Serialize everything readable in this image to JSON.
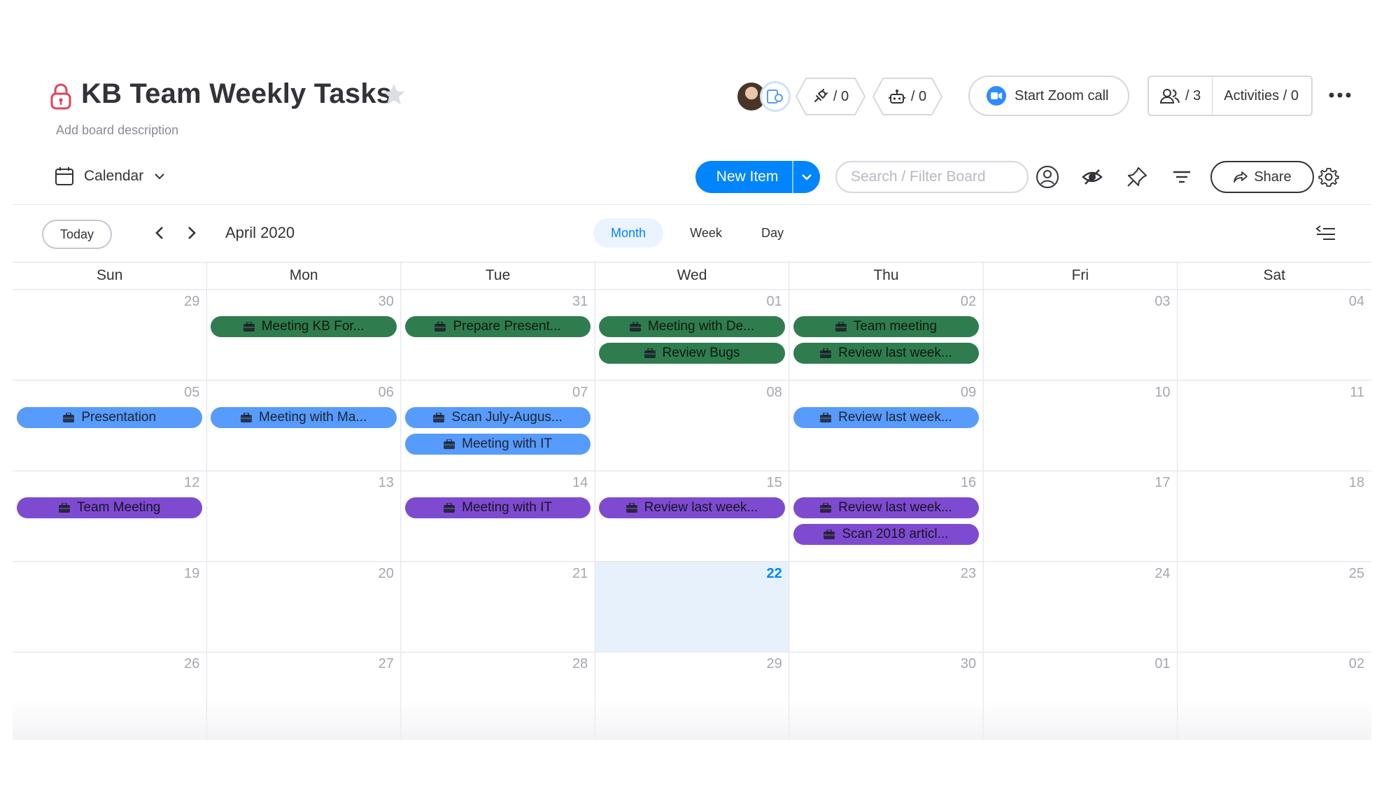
{
  "header": {
    "title": "KB Team Weekly Tasks",
    "description": "Add board description",
    "integrations_count": "/ 0",
    "automations_count": "/ 0",
    "zoom_label": "Start Zoom call",
    "members_count": "/ 3",
    "activities_label": "Activities / 0"
  },
  "toolbar": {
    "view_name": "Calendar",
    "new_item_label": "New Item",
    "search_placeholder": "Search / Filter Board",
    "share_label": "Share"
  },
  "calendar": {
    "today_label": "Today",
    "month_label": "April 2020",
    "view_tabs": [
      "Month",
      "Week",
      "Day"
    ],
    "active_view": "Month",
    "day_headers": [
      "Sun",
      "Mon",
      "Tue",
      "Wed",
      "Thu",
      "Fri",
      "Sat"
    ],
    "today_date": "22",
    "weeks": [
      [
        "29",
        "30",
        "31",
        "01",
        "02",
        "03",
        "04"
      ],
      [
        "05",
        "06",
        "07",
        "08",
        "09",
        "10",
        "11"
      ],
      [
        "12",
        "13",
        "14",
        "15",
        "16",
        "17",
        "18"
      ],
      [
        "19",
        "20",
        "21",
        "22",
        "23",
        "24",
        "25"
      ],
      [
        "26",
        "27",
        "28",
        "29",
        "30",
        "01",
        "02"
      ]
    ],
    "events": [
      {
        "week": 0,
        "day": 1,
        "slot": 0,
        "label": "Meeting KB For...",
        "group": "green"
      },
      {
        "week": 0,
        "day": 2,
        "slot": 0,
        "label": "Prepare Present...",
        "group": "green"
      },
      {
        "week": 0,
        "day": 3,
        "slot": 0,
        "label": "Meeting with De...",
        "group": "green"
      },
      {
        "week": 0,
        "day": 3,
        "slot": 1,
        "label": "Review Bugs",
        "group": "green"
      },
      {
        "week": 0,
        "day": 4,
        "slot": 0,
        "label": "Team meeting",
        "group": "green"
      },
      {
        "week": 0,
        "day": 4,
        "slot": 1,
        "label": "Review last week...",
        "group": "green"
      },
      {
        "week": 1,
        "day": 0,
        "slot": 0,
        "label": "Presentation",
        "group": "blue"
      },
      {
        "week": 1,
        "day": 1,
        "slot": 0,
        "label": "Meeting with Ma...",
        "group": "blue"
      },
      {
        "week": 1,
        "day": 2,
        "slot": 0,
        "label": "Scan July-Augus...",
        "group": "blue"
      },
      {
        "week": 1,
        "day": 2,
        "slot": 1,
        "label": "Meeting with IT",
        "group": "blue"
      },
      {
        "week": 1,
        "day": 4,
        "slot": 0,
        "label": "Review last week...",
        "group": "blue"
      },
      {
        "week": 2,
        "day": 0,
        "slot": 0,
        "label": "Team Meeting",
        "group": "purple"
      },
      {
        "week": 2,
        "day": 2,
        "slot": 0,
        "label": "Meeting with IT",
        "group": "purple"
      },
      {
        "week": 2,
        "day": 3,
        "slot": 0,
        "label": "Review last week...",
        "group": "purple"
      },
      {
        "week": 2,
        "day": 4,
        "slot": 0,
        "label": "Review last week...",
        "group": "purple"
      },
      {
        "week": 2,
        "day": 4,
        "slot": 1,
        "label": "Scan 2018 articl...",
        "group": "purple"
      }
    ]
  },
  "colors": {
    "accent": "#0085ff",
    "group_green": "#2f7d4f",
    "group_blue": "#579bfc",
    "group_purple": "#7e4bd0",
    "today_highlight": "#e7f1fc"
  },
  "icons": {
    "lock": "lock-icon",
    "favorite": "star-icon",
    "integrations": "plug-icon",
    "automations": "robot-icon",
    "zoom": "video-camera-icon",
    "members": "people-icon",
    "more": "more-horizontal-icon",
    "calendar": "calendar-icon",
    "person_filter": "person-icon",
    "hide": "eye-slash-icon",
    "pin": "pin-icon",
    "filter": "filter-icon",
    "share": "share-arrow-icon",
    "settings": "gear-icon",
    "collapse": "collapse-list-icon",
    "event": "briefcase-icon"
  }
}
